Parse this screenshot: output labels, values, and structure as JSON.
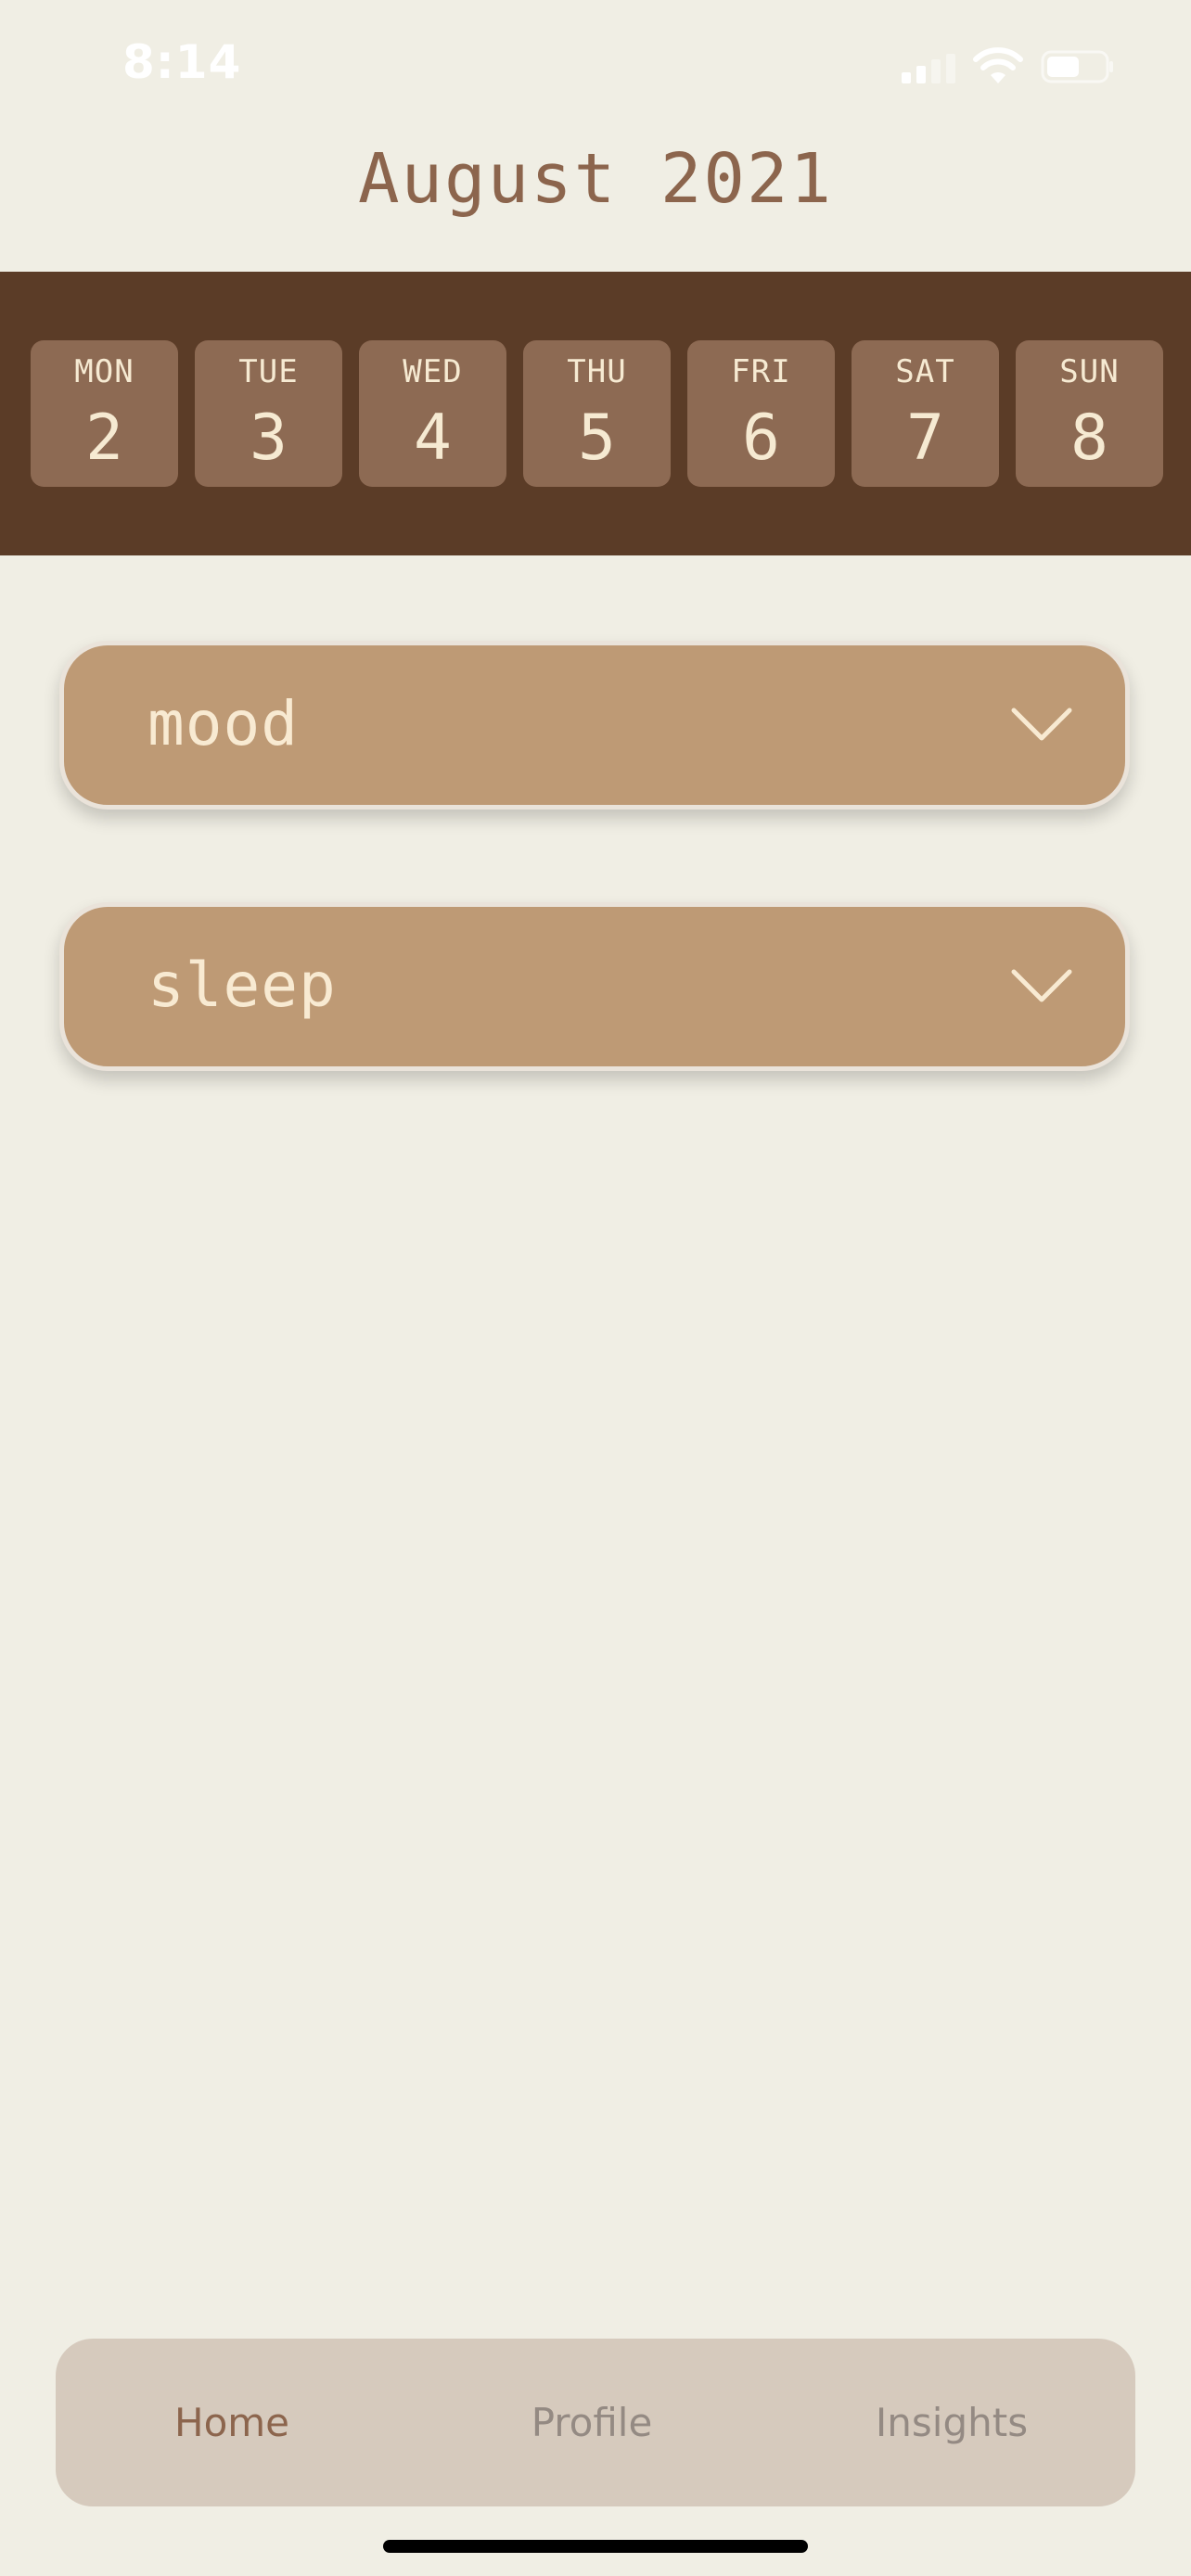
{
  "status_bar": {
    "time": "8:14",
    "icons": [
      "signal-icon",
      "wifi-icon",
      "battery-icon"
    ]
  },
  "header": {
    "title": "August 2021"
  },
  "week": {
    "days": [
      {
        "name": "MON",
        "num": "2"
      },
      {
        "name": "TUE",
        "num": "3"
      },
      {
        "name": "WED",
        "num": "4"
      },
      {
        "name": "THU",
        "num": "5"
      },
      {
        "name": "FRI",
        "num": "6"
      },
      {
        "name": "SAT",
        "num": "7"
      },
      {
        "name": "SUN",
        "num": "8"
      }
    ]
  },
  "sections": [
    {
      "label": "mood",
      "icon": "chevron-down-icon"
    },
    {
      "label": "sleep",
      "icon": "chevron-down-icon"
    }
  ],
  "tabs": [
    {
      "label": "Home",
      "active": true
    },
    {
      "label": "Profile",
      "active": false
    },
    {
      "label": "Insights",
      "active": false
    }
  ],
  "colors": {
    "background": "#f0eee4",
    "week_strip": "#5b3c27",
    "day_tile": "#8d6a53",
    "card": "#be9a75",
    "accent_text": "#8c654d",
    "tab_bar": "#d6cabd"
  }
}
